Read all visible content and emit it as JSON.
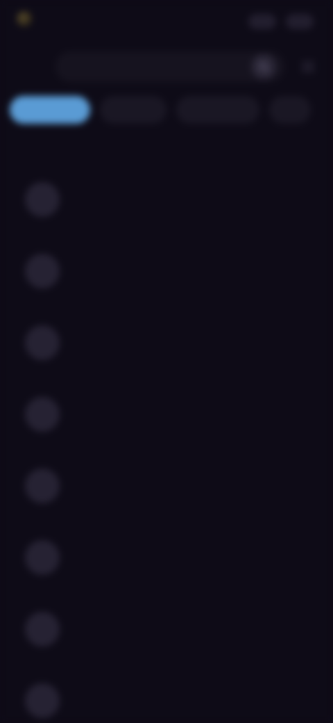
{
  "app": {
    "name": "",
    "accent": "#5a9bd4",
    "background": "#0e0b17"
  },
  "top_actions": [
    {
      "label": ""
    },
    {
      "label": ""
    }
  ],
  "search": {
    "placeholder": "",
    "value": "",
    "icon": "search-icon"
  },
  "menu_icon": "menu-icon",
  "tabs": [
    {
      "label": "",
      "active": true
    },
    {
      "label": "",
      "active": false
    },
    {
      "label": "",
      "active": false
    },
    {
      "label": "",
      "active": false
    }
  ],
  "section_label": "",
  "items": [
    {
      "title": "",
      "subtitle": ""
    },
    {
      "title": "",
      "subtitle": ""
    },
    {
      "title": "",
      "subtitle": ""
    },
    {
      "title": "",
      "subtitle": ""
    },
    {
      "title": "",
      "subtitle": ""
    },
    {
      "title": "",
      "subtitle": ""
    },
    {
      "title": "",
      "subtitle": ""
    },
    {
      "title": "",
      "subtitle": ""
    }
  ]
}
